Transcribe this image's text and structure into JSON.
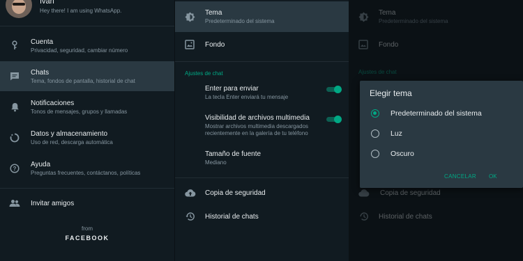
{
  "profile": {
    "name": "Ivan",
    "status": "Hey there! I am using WhatsApp."
  },
  "settings_menu": {
    "items": [
      {
        "label": "Cuenta",
        "sub": "Privacidad, seguridad, cambiar número",
        "icon": "key-icon"
      },
      {
        "label": "Chats",
        "sub": "Tema, fondos de pantalla, historial de chat",
        "icon": "chat-icon"
      },
      {
        "label": "Notificaciones",
        "sub": "Tonos de mensajes, grupos y llamadas",
        "icon": "bell-icon"
      },
      {
        "label": "Datos y almacenamiento",
        "sub": "Uso de red, descarga automática",
        "icon": "data-icon"
      },
      {
        "label": "Ayuda",
        "sub": "Preguntas frecuentes, contáctanos, políticas",
        "icon": "help-icon"
      }
    ],
    "invite": "Invitar amigos",
    "from": "from",
    "brand": "FACEBOOK"
  },
  "chat_settings": {
    "theme": {
      "label": "Tema",
      "sub": "Predeterminado del sistema"
    },
    "wallpaper": "Fondo",
    "section": "Ajustes de chat",
    "enter_send": {
      "label": "Enter para enviar",
      "sub": "La tecla Enter enviará tu mensaje",
      "on": true
    },
    "media_visibility": {
      "label": "Visibilidad de archivos multimedia",
      "sub1": "Mostrar archivos multimedia descargados",
      "sub2": "recientemente en la galería de tu teléfono",
      "on": true
    },
    "font_size": {
      "label": "Tamaño de fuente",
      "sub": "Mediano"
    },
    "backup": "Copia de seguridad",
    "history": "Historial de chats"
  },
  "dialog": {
    "title": "Elegir tema",
    "options": [
      "Predeterminado del sistema",
      "Luz",
      "Oscuro"
    ],
    "selected": 0,
    "cancel": "CANCELAR",
    "ok": "OK"
  },
  "colors": {
    "accent": "#00a884",
    "background": "#111b21",
    "dialog": "#2a3942",
    "selected_row": "#2a3942"
  }
}
